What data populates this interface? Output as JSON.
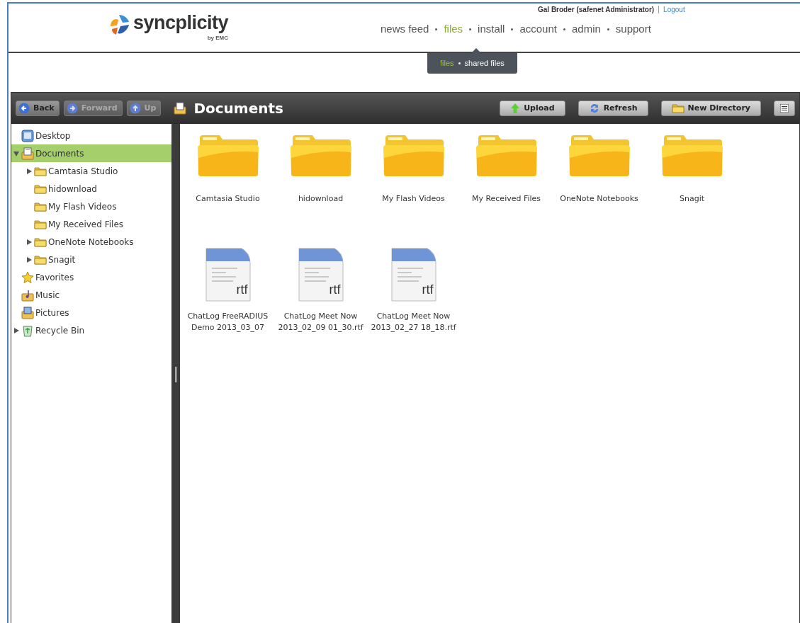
{
  "header": {
    "logo": {
      "name": "syncplicity",
      "tagline": "by EMC"
    },
    "user": "Gal Broder (safenet Administrator)",
    "logout": "Logout",
    "nav": [
      {
        "label": "news feed",
        "selected": false
      },
      {
        "label": "files",
        "selected": true
      },
      {
        "label": "install",
        "selected": false
      },
      {
        "label": "account",
        "selected": false
      },
      {
        "label": "admin",
        "selected": false
      },
      {
        "label": "support",
        "selected": false
      }
    ],
    "subnav": [
      {
        "label": "files",
        "selected": true
      },
      {
        "label": "shared files",
        "selected": false
      }
    ]
  },
  "toolbar": {
    "nav_buttons": [
      {
        "label": "Back",
        "kind": "back",
        "disabled": false
      },
      {
        "label": "Forward",
        "kind": "forward",
        "disabled": true
      },
      {
        "label": "Up",
        "kind": "up",
        "disabled": true
      }
    ],
    "title": "Documents",
    "actions": [
      {
        "label": "Upload",
        "kind": "upload"
      },
      {
        "label": "Refresh",
        "kind": "refresh"
      },
      {
        "label": "New Directory",
        "kind": "folder"
      }
    ]
  },
  "tree": [
    {
      "label": "Desktop",
      "kind": "desktop",
      "expandable": false,
      "selected": false
    },
    {
      "label": "Documents",
      "kind": "documents",
      "expandable": true,
      "expanded": true,
      "selected": true,
      "children": [
        {
          "label": "Camtasia Studio",
          "kind": "folder",
          "expandable": true,
          "expanded": false,
          "selected": false
        },
        {
          "label": "hidownload",
          "kind": "folder",
          "expandable": false,
          "selected": false
        },
        {
          "label": "My Flash Videos",
          "kind": "folder",
          "expandable": false,
          "selected": false
        },
        {
          "label": "My Received Files",
          "kind": "folder",
          "expandable": false,
          "selected": false
        },
        {
          "label": "OneNote Notebooks",
          "kind": "folder",
          "expandable": true,
          "expanded": false,
          "selected": false
        },
        {
          "label": "Snagit",
          "kind": "folder",
          "expandable": true,
          "expanded": false,
          "selected": false
        }
      ]
    },
    {
      "label": "Favorites",
      "kind": "favorites",
      "expandable": false,
      "selected": false
    },
    {
      "label": "Music",
      "kind": "music",
      "expandable": false,
      "selected": false
    },
    {
      "label": "Pictures",
      "kind": "pictures",
      "expandable": false,
      "selected": false
    },
    {
      "label": "Recycle Bin",
      "kind": "recycle",
      "expandable": true,
      "expanded": false,
      "selected": false
    }
  ],
  "items": [
    {
      "name": "Camtasia Studio",
      "kind": "folder"
    },
    {
      "name": "hidownload",
      "kind": "folder"
    },
    {
      "name": "My Flash Videos",
      "kind": "folder"
    },
    {
      "name": "My Received Files",
      "kind": "folder"
    },
    {
      "name": "OneNote Notebooks",
      "kind": "folder"
    },
    {
      "name": "Snagit",
      "kind": "folder"
    },
    {
      "name": "ChatLog FreeRADIUS Demo 2013_03_07",
      "kind": "file",
      "ext": "rtf"
    },
    {
      "name": "ChatLog Meet Now 2013_02_09 01_30.rtf",
      "kind": "file",
      "ext": "rtf"
    },
    {
      "name": "ChatLog Meet Now 2013_02_27 18_18.rtf",
      "kind": "file",
      "ext": "rtf"
    }
  ]
}
